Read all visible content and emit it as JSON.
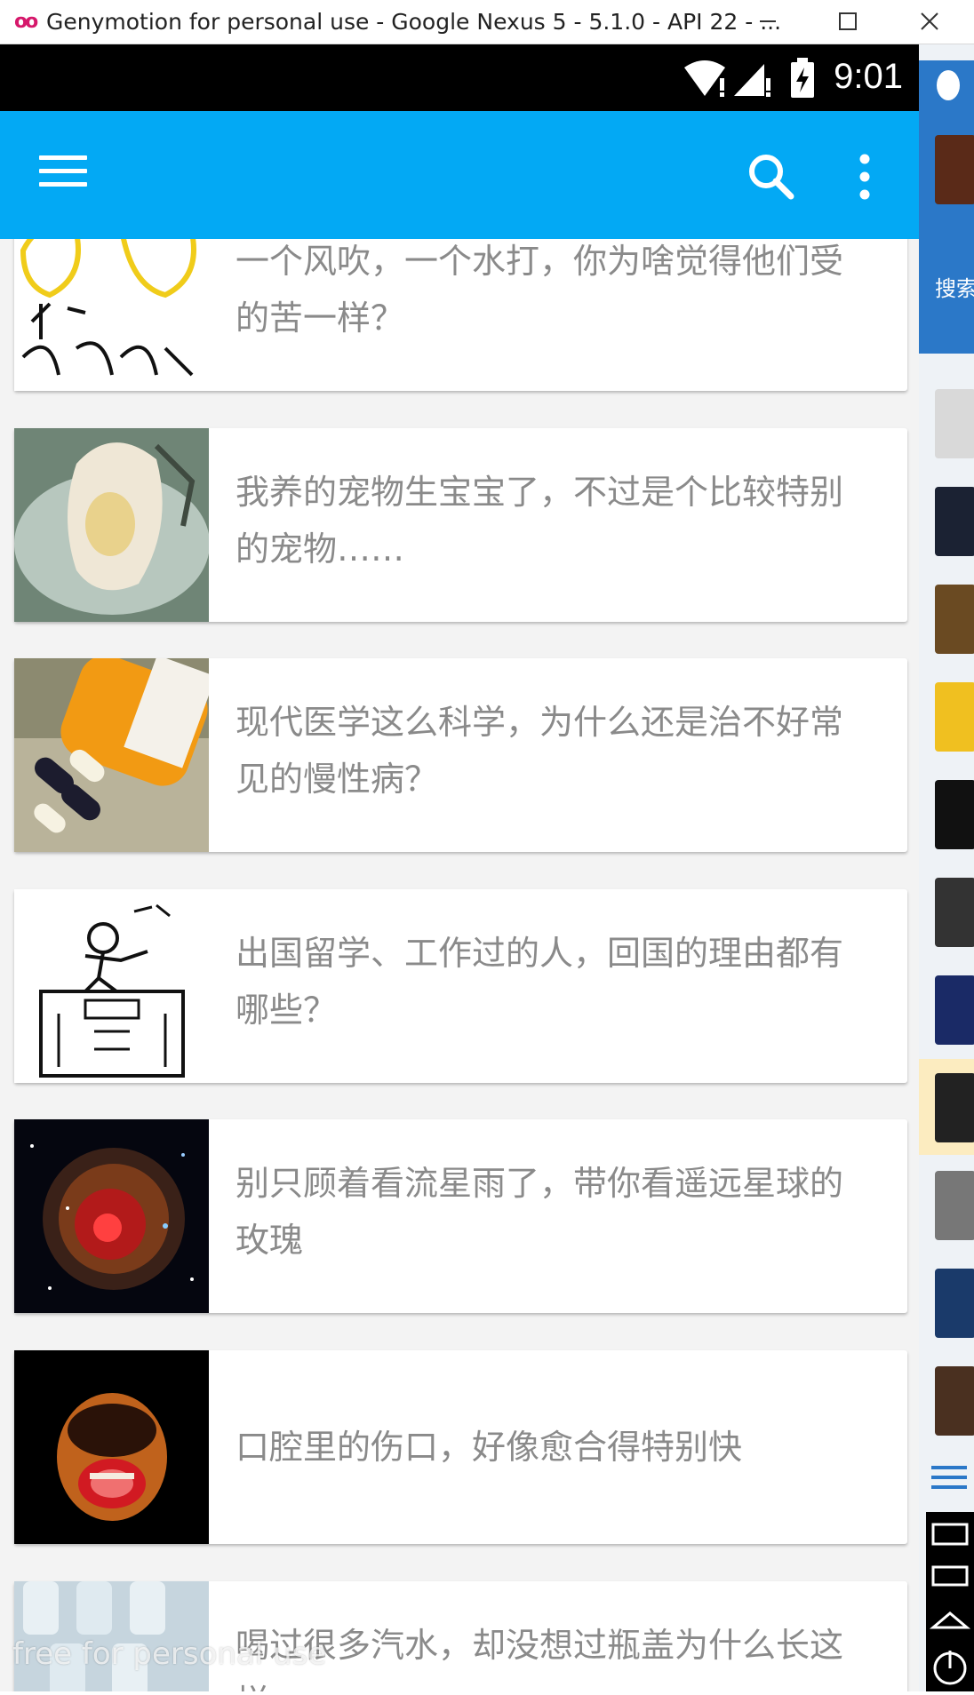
{
  "window": {
    "logo": "oo",
    "title": "Genymotion for personal use - Google Nexus 5 - 5.1.0 - API 22 - ..."
  },
  "statusbar": {
    "time": "9:01"
  },
  "toolbar": {
    "menu_icon": "hamburger-menu-icon",
    "search_icon": "search-icon",
    "more_icon": "more-vertical-icon"
  },
  "feed": {
    "items": [
      {
        "title": "一个风吹，一个水打，你为啥觉得他们受的苦一样？",
        "image": "duck-drawing"
      },
      {
        "title": "我养的宠物生宝宝了，不过是个比较特别的宠物……",
        "image": "pet-photo"
      },
      {
        "title": "现代医学这么科学，为什么还是治不好常见的慢性病？",
        "image": "pills-photo"
      },
      {
        "title": "出国留学、工作过的人，回国的理由都有哪些？",
        "image": "stickman-drawing"
      },
      {
        "title": "别只顾着看流星雨了，带你看遥远星球的玫瑰",
        "image": "space-photo"
      },
      {
        "title": "口腔里的伤口，好像愈合得特别快",
        "image": "mouth-photo"
      },
      {
        "title": "喝过很多汽水，却没想过瓶盖为什么长这样",
        "image": "bottles-photo"
      }
    ]
  },
  "side_panel": {
    "search_label": "搜索"
  },
  "watermark": "free for personal use",
  "colors": {
    "toolbar": "#03a9f4",
    "title_text": "#8a8a8a",
    "card_bg": "#ffffff"
  }
}
